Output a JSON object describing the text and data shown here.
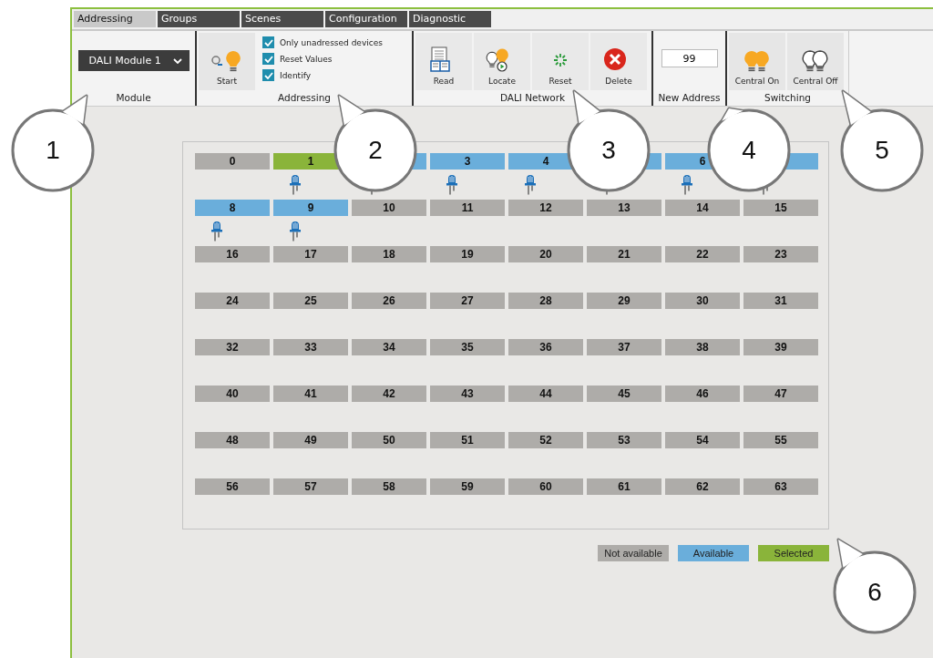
{
  "tabs": [
    {
      "label": "Addressing",
      "selected": true
    },
    {
      "label": "Groups",
      "selected": false
    },
    {
      "label": "Scenes",
      "selected": false
    },
    {
      "label": "Configuration",
      "selected": false
    },
    {
      "label": "Diagnostic",
      "selected": false
    }
  ],
  "ribbon": {
    "module": {
      "dropdown": "DALI Module 1",
      "label": "Module"
    },
    "addressing": {
      "start": "Start",
      "options": [
        {
          "label": "Only unadressed devices",
          "checked": true
        },
        {
          "label": "Reset Values",
          "checked": true
        },
        {
          "label": "Identify",
          "checked": true
        }
      ],
      "label": "Addressing"
    },
    "dali_network": {
      "buttons": [
        {
          "kind": "read",
          "label": "Read"
        },
        {
          "kind": "locate",
          "label": "Locate"
        },
        {
          "kind": "reset",
          "label": "Reset"
        },
        {
          "kind": "delete",
          "label": "Delete"
        }
      ],
      "label": "DALI Network"
    },
    "new_address": {
      "value": "99",
      "label": "New Address"
    },
    "switching": {
      "buttons": [
        {
          "kind": "on",
          "label": "Central On"
        },
        {
          "kind": "off",
          "label": "Central Off"
        }
      ],
      "label": "Switching"
    }
  },
  "addresses": [
    {
      "label": "0",
      "available": false,
      "selected": false,
      "device": false
    },
    {
      "label": "1",
      "selected": true,
      "device": true
    },
    {
      "available": true,
      "selected": false,
      "device": true
    },
    {
      "label": "3",
      "available": true,
      "selected": false,
      "device": true
    },
    {
      "label": "4",
      "available": true,
      "selected": false,
      "device": true
    },
    {
      "available": true,
      "selected": false,
      "device": true
    },
    {
      "label": "6",
      "available": true,
      "selected": false,
      "device": true
    },
    {
      "available": true,
      "selected": false,
      "device": true
    },
    {
      "label": "8",
      "available": true,
      "selected": false,
      "device": true
    },
    {
      "label": "9",
      "available": true,
      "selected": false,
      "device": true
    },
    {
      "label": "10",
      "available": false,
      "selected": false,
      "device": false
    },
    {
      "label": "11",
      "available": false,
      "selected": false,
      "device": false
    },
    {
      "label": "12",
      "available": false,
      "selected": false,
      "device": false
    },
    {
      "label": "13",
      "available": false,
      "selected": false,
      "device": false
    },
    {
      "label": "14",
      "available": false,
      "selected": false,
      "device": false
    },
    {
      "label": "15",
      "available": false,
      "selected": false,
      "device": false
    },
    {
      "label": "16",
      "available": false,
      "selected": false,
      "device": false
    },
    {
      "label": "17",
      "available": false,
      "selected": false,
      "device": false
    },
    {
      "label": "18",
      "available": false,
      "selected": false,
      "device": false
    },
    {
      "label": "19",
      "available": false,
      "selected": false,
      "device": false
    },
    {
      "label": "20",
      "available": false,
      "selected": false,
      "device": false
    },
    {
      "label": "21",
      "available": false,
      "selected": false,
      "device": false
    },
    {
      "label": "22",
      "available": false,
      "selected": false,
      "device": false
    },
    {
      "label": "23",
      "available": false,
      "selected": false,
      "device": false
    },
    {
      "label": "24",
      "available": false,
      "selected": false,
      "device": false
    },
    {
      "label": "25",
      "available": false,
      "selected": false,
      "device": false
    },
    {
      "label": "26",
      "available": false,
      "selected": false,
      "device": false
    },
    {
      "label": "27",
      "available": false,
      "selected": false,
      "device": false
    },
    {
      "label": "28",
      "available": false,
      "selected": false,
      "device": false
    },
    {
      "label": "29",
      "available": false,
      "selected": false,
      "device": false
    },
    {
      "label": "30",
      "available": false,
      "selected": false,
      "device": false
    },
    {
      "label": "31",
      "available": false,
      "selected": false,
      "device": false
    },
    {
      "label": "32",
      "available": false,
      "selected": false,
      "device": false
    },
    {
      "label": "33",
      "available": false,
      "selected": false,
      "device": false
    },
    {
      "label": "34",
      "available": false,
      "selected": false,
      "device": false
    },
    {
      "label": "35",
      "available": false,
      "selected": false,
      "device": false
    },
    {
      "label": "36",
      "available": false,
      "selected": false,
      "device": false
    },
    {
      "label": "37",
      "available": false,
      "selected": false,
      "device": false
    },
    {
      "label": "38",
      "available": false,
      "selected": false,
      "device": false
    },
    {
      "label": "39",
      "available": false,
      "selected": false,
      "device": false
    },
    {
      "label": "40",
      "available": false,
      "selected": false,
      "device": false
    },
    {
      "label": "41",
      "available": false,
      "selected": false,
      "device": false
    },
    {
      "label": "42",
      "available": false,
      "selected": false,
      "device": false
    },
    {
      "label": "43",
      "available": false,
      "selected": false,
      "device": false
    },
    {
      "label": "44",
      "available": false,
      "selected": false,
      "device": false
    },
    {
      "label": "45",
      "available": false,
      "selected": false,
      "device": false
    },
    {
      "label": "46",
      "available": false,
      "selected": false,
      "device": false
    },
    {
      "label": "47",
      "available": false,
      "selected": false,
      "device": false
    },
    {
      "label": "48",
      "available": false,
      "selected": false,
      "device": false
    },
    {
      "label": "49",
      "available": false,
      "selected": false,
      "device": false
    },
    {
      "label": "50",
      "available": false,
      "selected": false,
      "device": false
    },
    {
      "label": "51",
      "available": false,
      "selected": false,
      "device": false
    },
    {
      "label": "52",
      "available": false,
      "selected": false,
      "device": false
    },
    {
      "label": "53",
      "available": false,
      "selected": false,
      "device": false
    },
    {
      "label": "54",
      "available": false,
      "selected": false,
      "device": false
    },
    {
      "label": "55",
      "available": false,
      "selected": false,
      "device": false
    },
    {
      "label": "56",
      "available": false,
      "selected": false,
      "device": false
    },
    {
      "label": "57",
      "available": false,
      "selected": false,
      "device": false
    },
    {
      "label": "58",
      "available": false,
      "selected": false,
      "device": false
    },
    {
      "label": "59",
      "available": false,
      "selected": false,
      "device": false
    },
    {
      "label": "60",
      "available": false,
      "selected": false,
      "device": false
    },
    {
      "label": "61",
      "available": false,
      "selected": false,
      "device": false
    },
    {
      "label": "62",
      "available": false,
      "selected": false,
      "device": false
    },
    {
      "label": "63",
      "available": false,
      "selected": false,
      "device": false
    }
  ],
  "legend": [
    {
      "label": "Not available",
      "color": "#aeaca9"
    },
    {
      "label": "Available",
      "color": "#6aaedb"
    },
    {
      "label": "Selected",
      "color": "#8ab43a"
    }
  ],
  "callouts": [
    "1",
    "2",
    "3",
    "4",
    "5",
    "6"
  ]
}
